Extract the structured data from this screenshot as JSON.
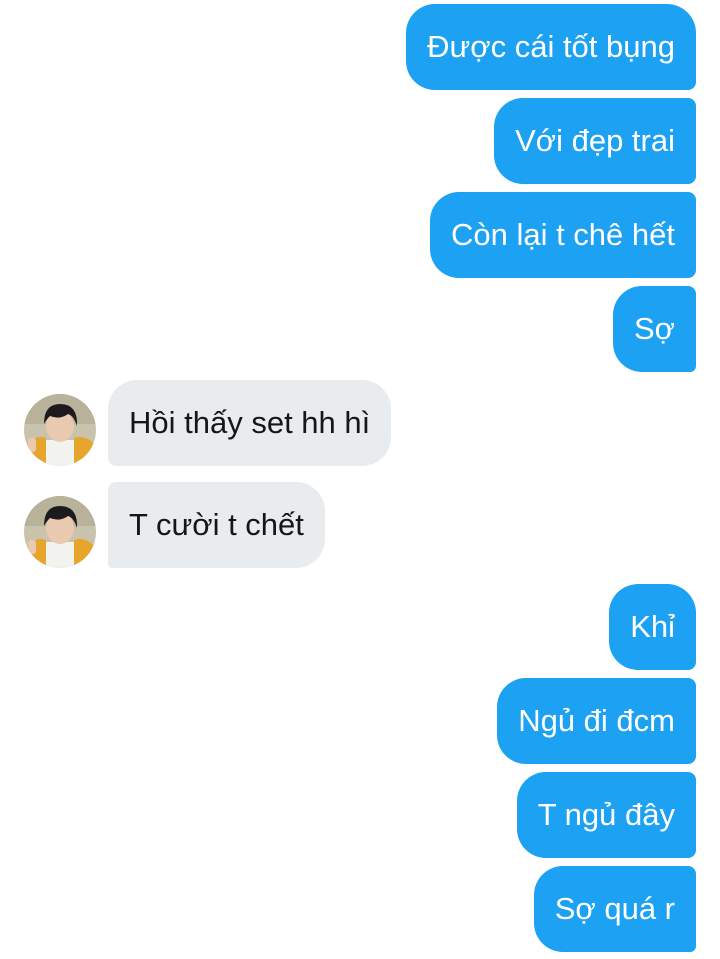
{
  "conversation": {
    "messages": [
      {
        "direction": "sent",
        "text": "Được cái tốt bụng"
      },
      {
        "direction": "sent",
        "text": "Với đẹp trai"
      },
      {
        "direction": "sent",
        "text": "Còn lại t chê hết"
      },
      {
        "direction": "sent",
        "text": "Sợ"
      },
      {
        "direction": "received",
        "text": "Hồi thấy set hh hì"
      },
      {
        "direction": "received",
        "text": "T cười t chết"
      },
      {
        "direction": "sent",
        "text": "Khỉ"
      },
      {
        "direction": "sent",
        "text": "Ngủ đi đcm"
      },
      {
        "direction": "sent",
        "text": "T ngủ đây"
      },
      {
        "direction": "sent",
        "text": "Sợ quá r"
      }
    ]
  },
  "colors": {
    "sent_bubble": "#1da1f2",
    "received_bubble": "#e8ecef",
    "sent_text": "#ffffff",
    "received_text": "#14171a"
  }
}
